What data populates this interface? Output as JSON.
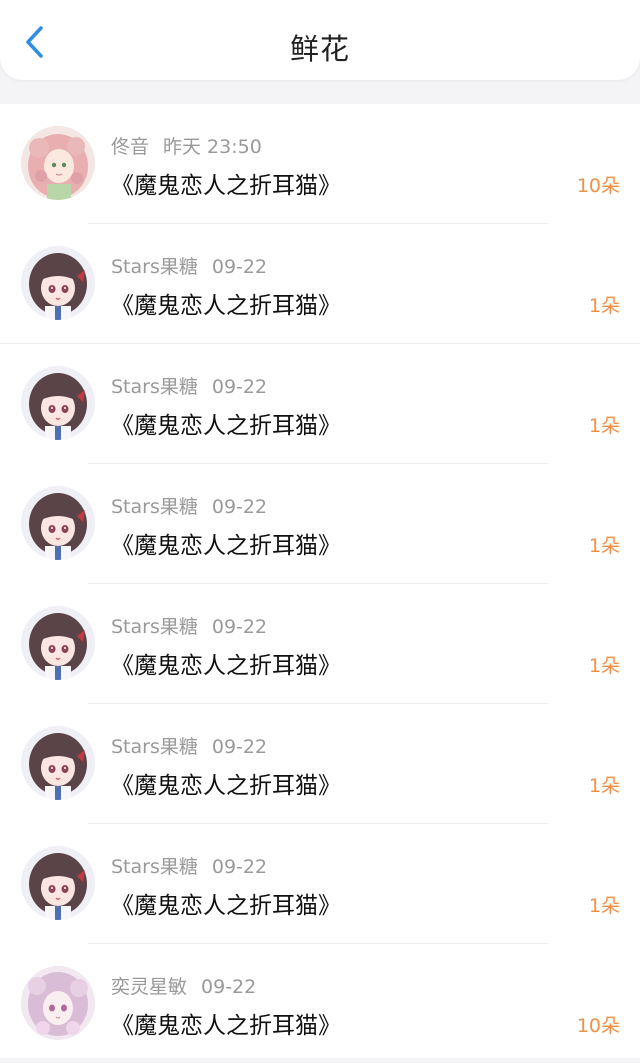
{
  "header": {
    "title": "鲜花",
    "back_icon": "chevron-left-icon",
    "accent": "#2f8de6"
  },
  "colors": {
    "count": "#f0904a",
    "meta": "#999999"
  },
  "items": [
    {
      "user": "佟音",
      "date": "昨天 23:50",
      "book": "《魔鬼恋人之折耳猫》",
      "count": "10朵",
      "avatar": "pink-hair-girl-avatar"
    },
    {
      "user": "Stars果糖",
      "date": "09-22",
      "book": "《魔鬼恋人之折耳猫》",
      "count": "1朵",
      "avatar": "brown-hair-girl-avatar"
    },
    {
      "user": "Stars果糖",
      "date": "09-22",
      "book": "《魔鬼恋人之折耳猫》",
      "count": "1朵",
      "avatar": "brown-hair-girl-avatar"
    },
    {
      "user": "Stars果糖",
      "date": "09-22",
      "book": "《魔鬼恋人之折耳猫》",
      "count": "1朵",
      "avatar": "brown-hair-girl-avatar"
    },
    {
      "user": "Stars果糖",
      "date": "09-22",
      "book": "《魔鬼恋人之折耳猫》",
      "count": "1朵",
      "avatar": "brown-hair-girl-avatar"
    },
    {
      "user": "Stars果糖",
      "date": "09-22",
      "book": "《魔鬼恋人之折耳猫》",
      "count": "1朵",
      "avatar": "brown-hair-girl-avatar"
    },
    {
      "user": "Stars果糖",
      "date": "09-22",
      "book": "《魔鬼恋人之折耳猫》",
      "count": "1朵",
      "avatar": "brown-hair-girl-avatar"
    },
    {
      "user": "奕灵星敏",
      "date": "09-22",
      "book": "《魔鬼恋人之折耳猫》",
      "count": "10朵",
      "avatar": "lilac-hair-girl-avatar"
    }
  ]
}
